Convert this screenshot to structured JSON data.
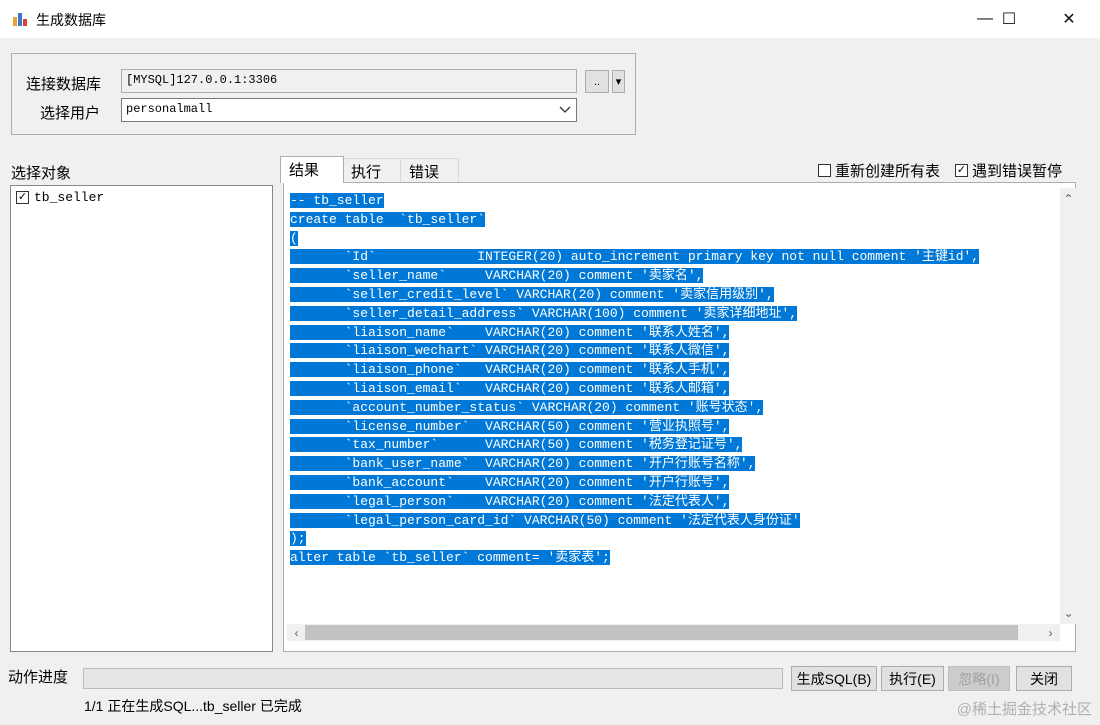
{
  "window": {
    "title": "生成数据库",
    "min": "—",
    "max": "☐",
    "close": "✕"
  },
  "connection": {
    "db_label": "连接数据库",
    "db_value": "[MYSQL]127.0.0.1:3306",
    "browse_label": "..",
    "dropdown_label": "▾",
    "user_label": "选择用户",
    "user_value": "personalmall"
  },
  "objects": {
    "label": "选择对象",
    "items": [
      {
        "name": "tb_seller",
        "checked": true
      }
    ]
  },
  "tabs": [
    "结果",
    "执行",
    "错误"
  ],
  "options": {
    "recreate_label": "重新创建所有表",
    "recreate_checked": false,
    "pause_label": "遇到错误暂停",
    "pause_checked": true
  },
  "code_lines": [
    "-- tb_seller",
    "create table  `tb_seller`",
    "(",
    "       `Id`             INTEGER(20) auto_increment primary key not null comment '主键id',",
    "       `seller_name`     VARCHAR(20) comment '卖家名',",
    "       `seller_credit_level` VARCHAR(20) comment '卖家信用级别',",
    "       `seller_detail_address` VARCHAR(100) comment '卖家详细地址',",
    "       `liaison_name`    VARCHAR(20) comment '联系人姓名',",
    "       `liaison_wechart` VARCHAR(20) comment '联系人微信',",
    "       `liaison_phone`   VARCHAR(20) comment '联系人手机',",
    "       `liaison_email`   VARCHAR(20) comment '联系人邮箱',",
    "       `account_number_status` VARCHAR(20) comment '账号状态',",
    "       `license_number`  VARCHAR(50) comment '营业执照号',",
    "       `tax_number`      VARCHAR(50) comment '税务登记证号',",
    "       `bank_user_name`  VARCHAR(20) comment '开户行账号名称',",
    "       `bank_account`    VARCHAR(20) comment '开户行账号',",
    "       `legal_person`    VARCHAR(20) comment '法定代表人',",
    "       `legal_person_card_id` VARCHAR(50) comment '法定代表人身份证'",
    ");",
    "alter table `tb_seller` comment= '卖家表';"
  ],
  "bottom": {
    "progress_label": "动作进度",
    "progress_value": 0,
    "status": "1/1 正在生成SQL...tb_seller 已完成",
    "btn_generate": "生成SQL(B)",
    "btn_execute": "执行(E)",
    "btn_ignore": "忽略(I)",
    "btn_close": "关闭"
  },
  "watermark": "@稀土掘金技术社区",
  "colors": {
    "selection": "#0078d7",
    "background": "#f0f0f0"
  }
}
